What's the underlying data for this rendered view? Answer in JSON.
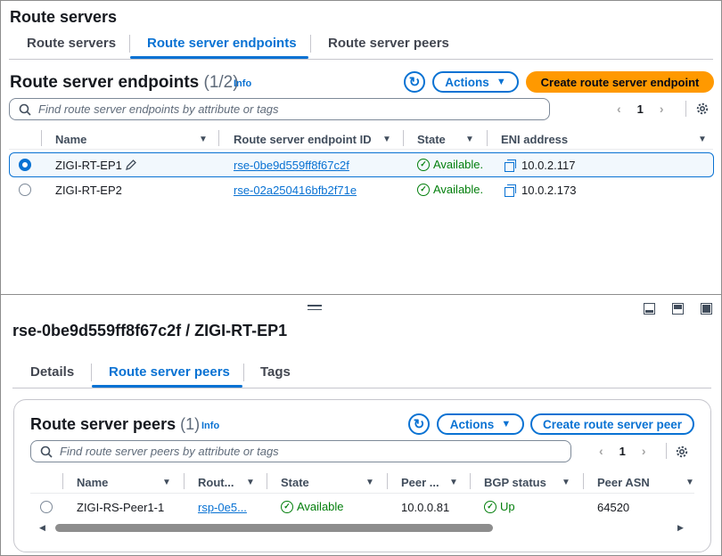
{
  "page": {
    "title": "Route servers"
  },
  "top_tabs": [
    {
      "label": "Route servers",
      "active": false
    },
    {
      "label": "Route server endpoints",
      "active": true
    },
    {
      "label": "Route server peers",
      "active": false
    }
  ],
  "endpoints": {
    "heading": "Route server endpoints",
    "count": "(1/2)",
    "info": "Info",
    "actions_label": "Actions",
    "create_label": "Create route server endpoint",
    "search_placeholder": "Find route server endpoints by attribute or tags",
    "page": "1",
    "columns": [
      "Name",
      "Route server endpoint ID",
      "State",
      "ENI address"
    ],
    "rows": [
      {
        "name": "ZIGI-RT-EP1",
        "id": "rse-0be9d559ff8f67c2f",
        "state": "Available.",
        "eni": "10.0.2.117",
        "selected": true
      },
      {
        "name": "ZIGI-RT-EP2",
        "id": "rse-02a250416bfb2f71e",
        "state": "Available.",
        "eni": "10.0.2.173",
        "selected": false
      }
    ]
  },
  "detail": {
    "title": "rse-0be9d559ff8f67c2f / ZIGI-RT-EP1",
    "tabs": [
      {
        "label": "Details",
        "active": false
      },
      {
        "label": "Route server peers",
        "active": true
      },
      {
        "label": "Tags",
        "active": false
      }
    ]
  },
  "peers": {
    "heading": "Route server peers",
    "count": "(1)",
    "info": "Info",
    "actions_label": "Actions",
    "create_label": "Create route server peer",
    "search_placeholder": "Find route server peers by attribute or tags",
    "page": "1",
    "columns": [
      "Name",
      "Rout...",
      "State",
      "Peer ...",
      "BGP status",
      "Peer ASN"
    ],
    "rows": [
      {
        "name": "ZIGI-RS-Peer1-1",
        "id": "rsp-0e5...",
        "state": "Available",
        "peer_address": "10.0.0.81",
        "bgp": "Up",
        "asn": "64520"
      }
    ]
  },
  "colors": {
    "accent": "#0972d3",
    "primary": "#ff9900",
    "success": "#037f0c"
  }
}
